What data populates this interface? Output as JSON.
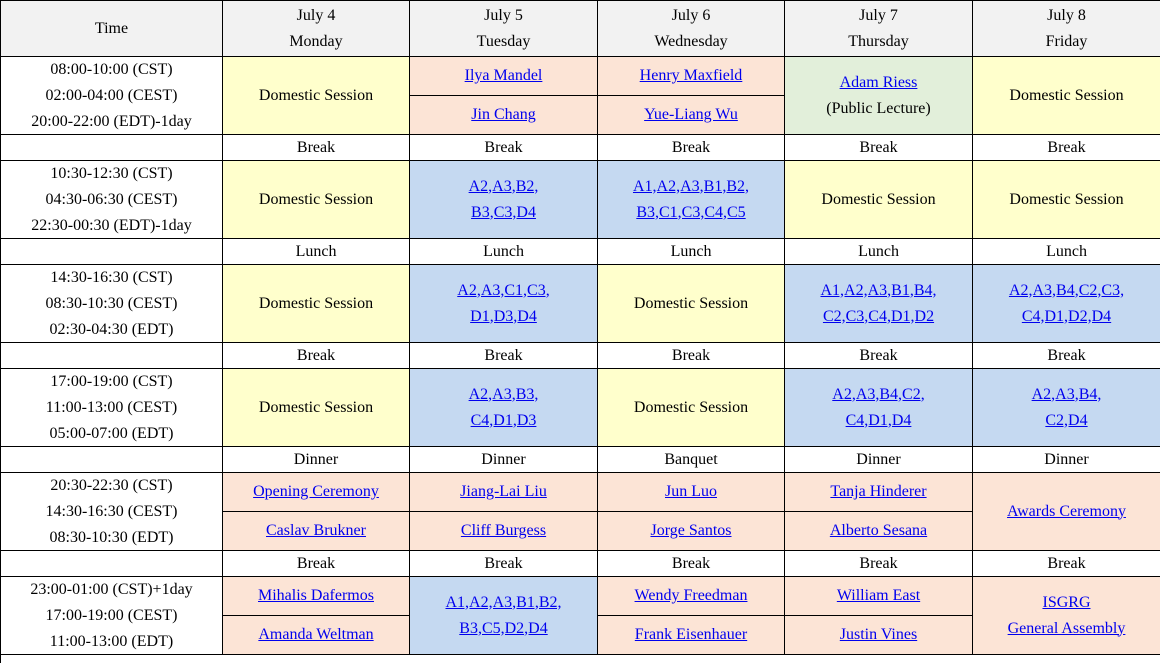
{
  "header": {
    "time_label": "Time",
    "days": [
      {
        "date": "July 4",
        "weekday": "Monday"
      },
      {
        "date": "July 5",
        "weekday": "Tuesday"
      },
      {
        "date": "July 6",
        "weekday": "Wednesday"
      },
      {
        "date": "July 7",
        "weekday": "Thursday"
      },
      {
        "date": "July 8",
        "weekday": "Friday"
      }
    ]
  },
  "colors": {
    "domestic": "#ffffcc",
    "plenary": "#fce4d6",
    "parallel": "#c5d9f1",
    "public_lecture": "#e2efda",
    "header": "#f2f2f2",
    "link": "#0000ee"
  },
  "blocks": [
    {
      "times": [
        "08:00-10:00 (CST)",
        "02:00-04:00 (CEST)",
        "20:00-22:00 (EDT)-1day"
      ],
      "cells": [
        {
          "kind": "domestic",
          "text": "Domestic Session"
        },
        {
          "kind": "plenary",
          "items": [
            "Ilya Mandel",
            "Jin Chang"
          ]
        },
        {
          "kind": "plenary",
          "items": [
            "Henry Maxfield",
            "Yue-Liang Wu"
          ]
        },
        {
          "kind": "public_lecture",
          "link": "Adam Riess",
          "note": "(Public Lecture)"
        },
        {
          "kind": "domestic",
          "text": "Domestic Session"
        }
      ]
    },
    {
      "separator": [
        "Break",
        "Break",
        "Break",
        "Break",
        "Break"
      ]
    },
    {
      "times": [
        "10:30-12:30 (CST)",
        "04:30-06:30 (CEST)",
        "22:30-00:30 (EDT)-1day"
      ],
      "cells": [
        {
          "kind": "domestic",
          "text": "Domestic Session"
        },
        {
          "kind": "parallel",
          "lines": [
            "A2,A3,B2,",
            "B3,C3,D4"
          ]
        },
        {
          "kind": "parallel",
          "lines": [
            "A1,A2,A3,B1,B2,",
            "B3,C1,C3,C4,C5"
          ]
        },
        {
          "kind": "domestic",
          "text": "Domestic Session"
        },
        {
          "kind": "domestic",
          "text": "Domestic Session"
        }
      ]
    },
    {
      "separator": [
        "Lunch",
        "Lunch",
        "Lunch",
        "Lunch",
        "Lunch"
      ]
    },
    {
      "times": [
        "14:30-16:30 (CST)",
        "08:30-10:30 (CEST)",
        "02:30-04:30 (EDT)"
      ],
      "cells": [
        {
          "kind": "domestic",
          "text": "Domestic Session"
        },
        {
          "kind": "parallel",
          "lines": [
            "A2,A3,C1,C3,",
            "D1,D3,D4"
          ]
        },
        {
          "kind": "domestic",
          "text": "Domestic Session"
        },
        {
          "kind": "parallel",
          "lines": [
            "A1,A2,A3,B1,B4,",
            "C2,C3,C4,D1,D2"
          ]
        },
        {
          "kind": "parallel",
          "lines": [
            "A2,A3,B4,C2,C3,",
            "C4,D1,D2,D4"
          ]
        }
      ]
    },
    {
      "separator": [
        "Break",
        "Break",
        "Break",
        "Break",
        "Break"
      ]
    },
    {
      "times": [
        "17:00-19:00 (CST)",
        "11:00-13:00 (CEST)",
        "05:00-07:00 (EDT)"
      ],
      "cells": [
        {
          "kind": "domestic",
          "text": "Domestic Session"
        },
        {
          "kind": "parallel",
          "lines": [
            "A2,A3,B3,",
            "C4,D1,D3"
          ]
        },
        {
          "kind": "domestic",
          "text": "Domestic Session"
        },
        {
          "kind": "parallel",
          "lines": [
            "A2,A3,B4,C2,",
            "C4,D1,D4"
          ]
        },
        {
          "kind": "parallel",
          "lines": [
            "A2,A3,B4,",
            "C2,D4"
          ]
        }
      ]
    },
    {
      "separator": [
        "Dinner",
        "Dinner",
        "Banquet",
        "Dinner",
        "Dinner"
      ]
    },
    {
      "times": [
        "20:30-22:30 (CST)",
        "14:30-16:30 (CEST)",
        "08:30-10:30 (EDT)"
      ],
      "cells": [
        {
          "kind": "plenary",
          "items": [
            "Opening Ceremony",
            "Caslav Brukner"
          ]
        },
        {
          "kind": "plenary",
          "items": [
            "Jiang-Lai Liu",
            "Cliff Burgess"
          ]
        },
        {
          "kind": "plenary",
          "items": [
            "Jun Luo",
            "Jorge Santos"
          ]
        },
        {
          "kind": "plenary",
          "items": [
            "Tanja Hinderer",
            "Alberto Sesana"
          ]
        },
        {
          "kind": "plenary-single",
          "lines": [
            "Awards Ceremony"
          ]
        }
      ]
    },
    {
      "separator": [
        "Break",
        "Break",
        "Break",
        "Break",
        "Break"
      ]
    },
    {
      "times": [
        "23:00-01:00 (CST)+1day",
        "17:00-19:00 (CEST)",
        "11:00-13:00 (EDT)"
      ],
      "cells": [
        {
          "kind": "plenary",
          "items": [
            "Mihalis Dafermos",
            "Amanda Weltman"
          ]
        },
        {
          "kind": "parallel",
          "lines": [
            "A1,A2,A3,B1,B2,",
            "B3,C5,D2,D4"
          ]
        },
        {
          "kind": "plenary",
          "items": [
            "Wendy Freedman",
            "Frank Eisenhauer"
          ]
        },
        {
          "kind": "plenary",
          "items": [
            "William East",
            "Justin Vines"
          ]
        },
        {
          "kind": "plenary-single",
          "lines": [
            "ISGRG",
            "General Assembly"
          ]
        }
      ]
    }
  ]
}
